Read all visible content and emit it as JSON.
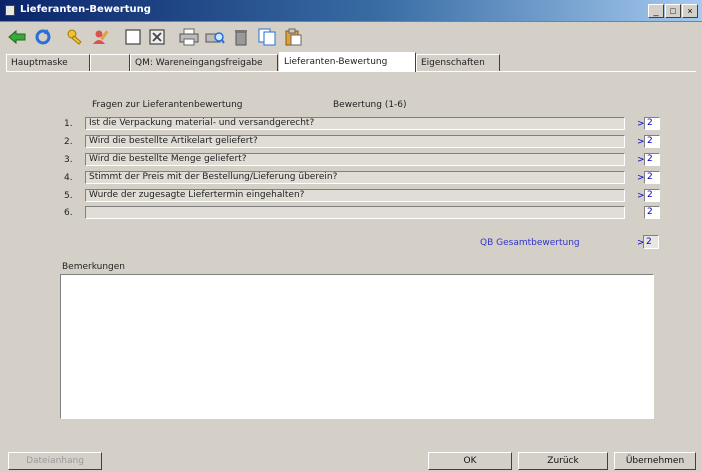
{
  "window": {
    "title": "Lieferanten-Bewertung",
    "min": "_",
    "max": "□",
    "close": "×"
  },
  "tabs": [
    {
      "label": "Hauptmaske"
    },
    {
      "label": ""
    },
    {
      "label": "QM: Wareneingangsfreigabe"
    },
    {
      "label": "Lieferanten-Bewertung"
    },
    {
      "label": "Eigenschaften"
    }
  ],
  "form": {
    "header_questions": "Fragen zur Lieferantenbewertung",
    "header_rating": "Bewertung (1-6)",
    "questions": [
      {
        "num": "1.",
        "text": "Ist die Verpackung material- und versandgerecht?",
        "gt": ">",
        "rating": "2"
      },
      {
        "num": "2.",
        "text": "Wird die bestellte Artikelart geliefert?",
        "gt": ">",
        "rating": "2"
      },
      {
        "num": "3.",
        "text": "Wird die bestellte Menge geliefert?",
        "gt": ">",
        "rating": "2"
      },
      {
        "num": "4.",
        "text": "Stimmt der Preis mit der Bestellung/Lieferung überein?",
        "gt": ">",
        "rating": "2"
      },
      {
        "num": "5.",
        "text": "Wurde der zugesagte Liefertermin eingehalten?",
        "gt": ">",
        "rating": "2"
      },
      {
        "num": "6.",
        "text": "",
        "gt": "",
        "rating": "2"
      }
    ],
    "gesamt_label": "QB Gesamtbewertung",
    "gesamt_gt": ">",
    "gesamt_value": "2",
    "bemerkungen_label": "Bemerkungen",
    "bemerkungen_value": ""
  },
  "buttons": {
    "dateianhang": "Dateianhang",
    "ok": "OK",
    "zurueck": "Zurück",
    "uebernehmen": "Übernehmen"
  }
}
